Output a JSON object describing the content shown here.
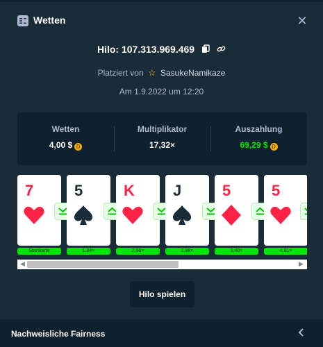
{
  "header": {
    "title": "Wetten",
    "icon": "bets-icon",
    "close_icon": "close-icon"
  },
  "bet": {
    "id_label": "Hilo: 107.313.969.469",
    "placed_by_prefix": "Platziert von",
    "username": "SasukeNamikaze",
    "date": "Am 1.9.2022 um 12:20"
  },
  "stats": {
    "wager_label": "Wetten",
    "wager_value": "4,00 $",
    "multiplier_label": "Multiplikator",
    "multiplier_value": "17,32×",
    "payout_label": "Auszahlung",
    "payout_value": "69,29 $",
    "coin_icon": "coin-icon"
  },
  "cards": [
    {
      "rank": "7",
      "suit": "heart",
      "color": "red",
      "multiplier": "Startkarte"
    },
    {
      "rank": "5",
      "suit": "spade",
      "color": "black",
      "multiplier": "1,84×"
    },
    {
      "rank": "K",
      "suit": "heart",
      "color": "red",
      "multiplier": "2,66×"
    },
    {
      "rank": "J",
      "suit": "spade",
      "color": "black",
      "multiplier": "2,88×"
    },
    {
      "rank": "5",
      "suit": "diamond",
      "color": "red",
      "multiplier": "3,40×"
    },
    {
      "rank": "5",
      "suit": "heart",
      "color": "red",
      "multiplier": "4,91×"
    }
  ],
  "guesses": [
    "lower-or-same",
    "higher-or-same",
    "lower-or-same",
    "lower-or-same",
    "higher-or-same",
    "lower-or-same"
  ],
  "scroll": {
    "left_icon": "scroll-left-arrow",
    "right_icon": "scroll-right-arrow"
  },
  "play_button": "Hilo spielen",
  "footer": {
    "title": "Nachweisliche Fairness",
    "chevron_icon": "chevron-left-icon"
  },
  "colors": {
    "background": "#1a2c38",
    "panel": "#0f212e",
    "accent_green": "#00e701",
    "card_red": "#fe2247",
    "card_black": "#1a2c38"
  }
}
